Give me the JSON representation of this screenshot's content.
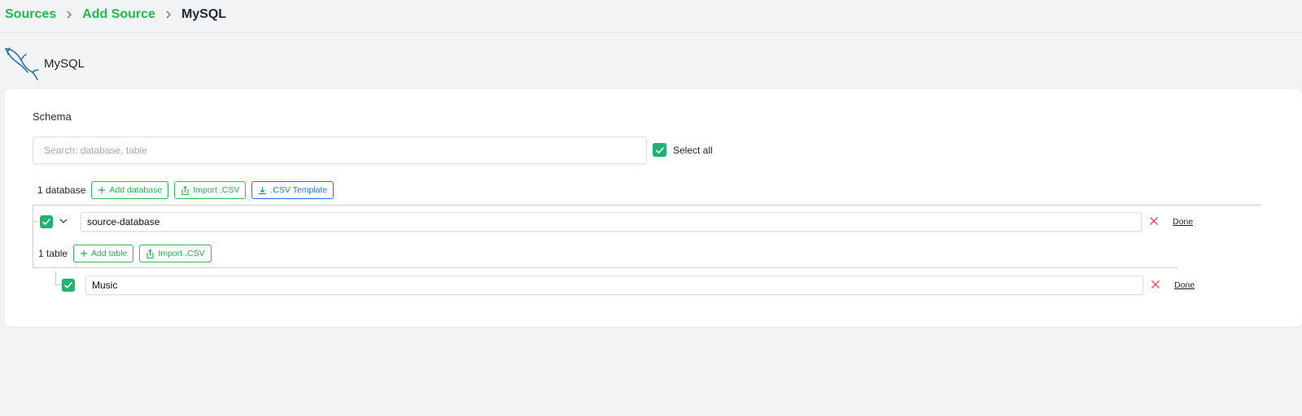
{
  "breadcrumb": {
    "items": [
      "Sources",
      "Add Source"
    ],
    "current": "MySQL"
  },
  "header": {
    "logo_icon": "mysql-dolphin-icon",
    "title": "MySQL"
  },
  "schema": {
    "label": "Schema",
    "search_placeholder": "Search: database, table",
    "select_all_label": "Select all",
    "select_all_checked": true,
    "database_count_label": "1 database",
    "buttons": {
      "add_database": "Add database",
      "import_csv": "Import .CSV",
      "csv_template": ".CSV Template"
    },
    "databases": [
      {
        "checked": true,
        "name": "source-database",
        "done_label": "Done",
        "table_count_label": "1 table",
        "buttons": {
          "add_table": "Add table",
          "import_csv": "Import .CSV"
        },
        "tables": [
          {
            "checked": true,
            "name": "Music",
            "done_label": "Done"
          }
        ]
      }
    ]
  },
  "colors": {
    "accent_green": "#21b94f",
    "checkbox_green": "#1fb36f",
    "link_blue": "#2f6ee6",
    "clear_red": "#e5484d"
  }
}
